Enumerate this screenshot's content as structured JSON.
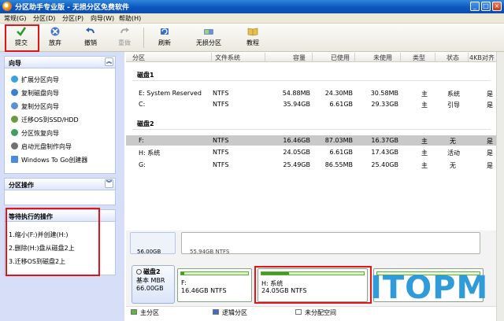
{
  "window": {
    "title": "分区助手专业版 - 无损分区免费软件"
  },
  "menu": [
    "常规(G)",
    "分区(D)",
    "分区(P)",
    "向导(W)",
    "帮助(H)"
  ],
  "toolbar": {
    "submit": "提交",
    "discard": "放弃",
    "undo": "撤销",
    "redo": "重做",
    "refresh": "刷新",
    "lossless": "无损分区",
    "tutorial": "教程"
  },
  "wizard": {
    "title": "向导",
    "items": [
      "扩展分区向导",
      "复制磁盘向导",
      "复制分区向导",
      "迁移OS到SSD/HDD",
      "分区恢复向导",
      "启动光盘制作向导",
      "Windows To Go创建器"
    ]
  },
  "partition_ops": {
    "title": "分区操作"
  },
  "pending": {
    "title": "等待执行的操作",
    "items": [
      "1.缩小(F:)并创建(H:)",
      "2.删除(H:)盘从磁盘2上",
      "3.迁移OS到磁盘2上"
    ]
  },
  "columns": [
    "分区",
    "文件系统",
    "容量",
    "已使用",
    "未使用",
    "类型",
    "状态",
    "4KB对齐"
  ],
  "disks": [
    {
      "label": "磁盘1",
      "rows": [
        [
          "E: System Reserved",
          "NTFS",
          "54.88MB",
          "24.30MB",
          "30.58MB",
          "主",
          "系统",
          "是"
        ],
        [
          "C:",
          "NTFS",
          "35.94GB",
          "6.61GB",
          "29.33GB",
          "主",
          "引导",
          "是"
        ]
      ]
    },
    {
      "label": "磁盘2",
      "rows": [
        [
          "F:",
          "NTFS",
          "16.46GB",
          "87.03MB",
          "16.37GB",
          "主",
          "无",
          "是"
        ],
        [
          "H: 系统",
          "NTFS",
          "24.05GB",
          "6.61GB",
          "17.43GB",
          "主",
          "活动",
          "是"
        ],
        [
          "G:",
          "NTFS",
          "25.49GB",
          "86.55MB",
          "25.40GB",
          "主",
          "无",
          "是"
        ]
      ]
    }
  ],
  "map": {
    "prev_size": "56.00GB",
    "prev_part": "55.94GB NTFS",
    "disk_name": "磁盘2",
    "disk_type": "基本 MBR",
    "disk_size": "66.00GB",
    "f_label": "F:",
    "f_info": "16.46GB NTFS",
    "f_used": 0.05,
    "h_label": "H: 系统",
    "h_info": "24.05GB NTFS",
    "h_used": 0.27
  },
  "legend": [
    "主分区",
    "逻辑分区",
    "未分配空间"
  ],
  "watermark": "ITOPM",
  "colors": {
    "accent": "#0c56c0",
    "highlight": "#e2141a",
    "partition_fill": "#3f9e1d",
    "watermark": "#2f9bd9"
  }
}
